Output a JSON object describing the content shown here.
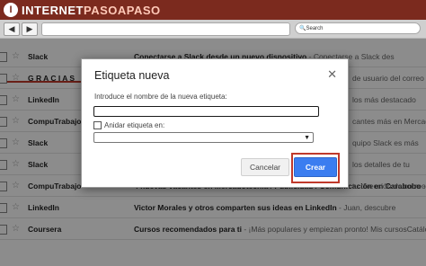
{
  "colors": {
    "brand": "#7b2a1e",
    "accent": "#3b7df0",
    "highlight": "#c0392b"
  },
  "header": {
    "logo_letter": "I",
    "logo_prefix": "INTERNET",
    "logo_suffix": "PASOAPASO"
  },
  "toolbar": {
    "search_text": "Search"
  },
  "inbox": {
    "rows": [
      {
        "sender": "Slack",
        "subject": "Conectarse a Slack desde un nuevo dispositivo",
        "snippet": " - Conectarse a Slack des"
      },
      {
        "sender": "G R A C I A S",
        "subject": "",
        "snippet": ""
      },
      {
        "sender": "LinkedIn",
        "subject": "",
        "snippet": ""
      },
      {
        "sender": "CompuTrabajo",
        "subject": "",
        "snippet": ""
      },
      {
        "sender": "Slack",
        "subject": "",
        "snippet": ""
      },
      {
        "sender": "Slack",
        "subject": "",
        "snippet": ""
      },
      {
        "sender": "CompuTrabajo",
        "subject": "4 nuevas vacantes en Mercadotécnia / Publicidad / Comunicación en Carabobo",
        "snippet": " - GEN"
      },
      {
        "sender": "LinkedIn",
        "subject": "Victor Morales y otros comparten sus ideas en LinkedIn",
        "snippet": " - Juan, descubre"
      },
      {
        "sender": "Coursera",
        "subject": "Cursos recomendados para ti",
        "snippet": " - ¡Más populares y empiezan pronto! Mis cursosCatálog"
      }
    ],
    "behind_dialog_snippets": [
      "de usuario del correo",
      "los más destacado",
      "cantes más en Mercad",
      "quipo Slack es más",
      "los detalles de tu",
      "tu dirección de correo"
    ]
  },
  "dialog": {
    "title": "Etiqueta nueva",
    "close_glyph": "✕",
    "name_label": "Introduce el nombre de la nueva etiqueta:",
    "name_value": "",
    "nest_label": "Anidar etiqueta en:",
    "parent_value": "",
    "cancel_label": "Cancelar",
    "create_label": "Crear"
  }
}
